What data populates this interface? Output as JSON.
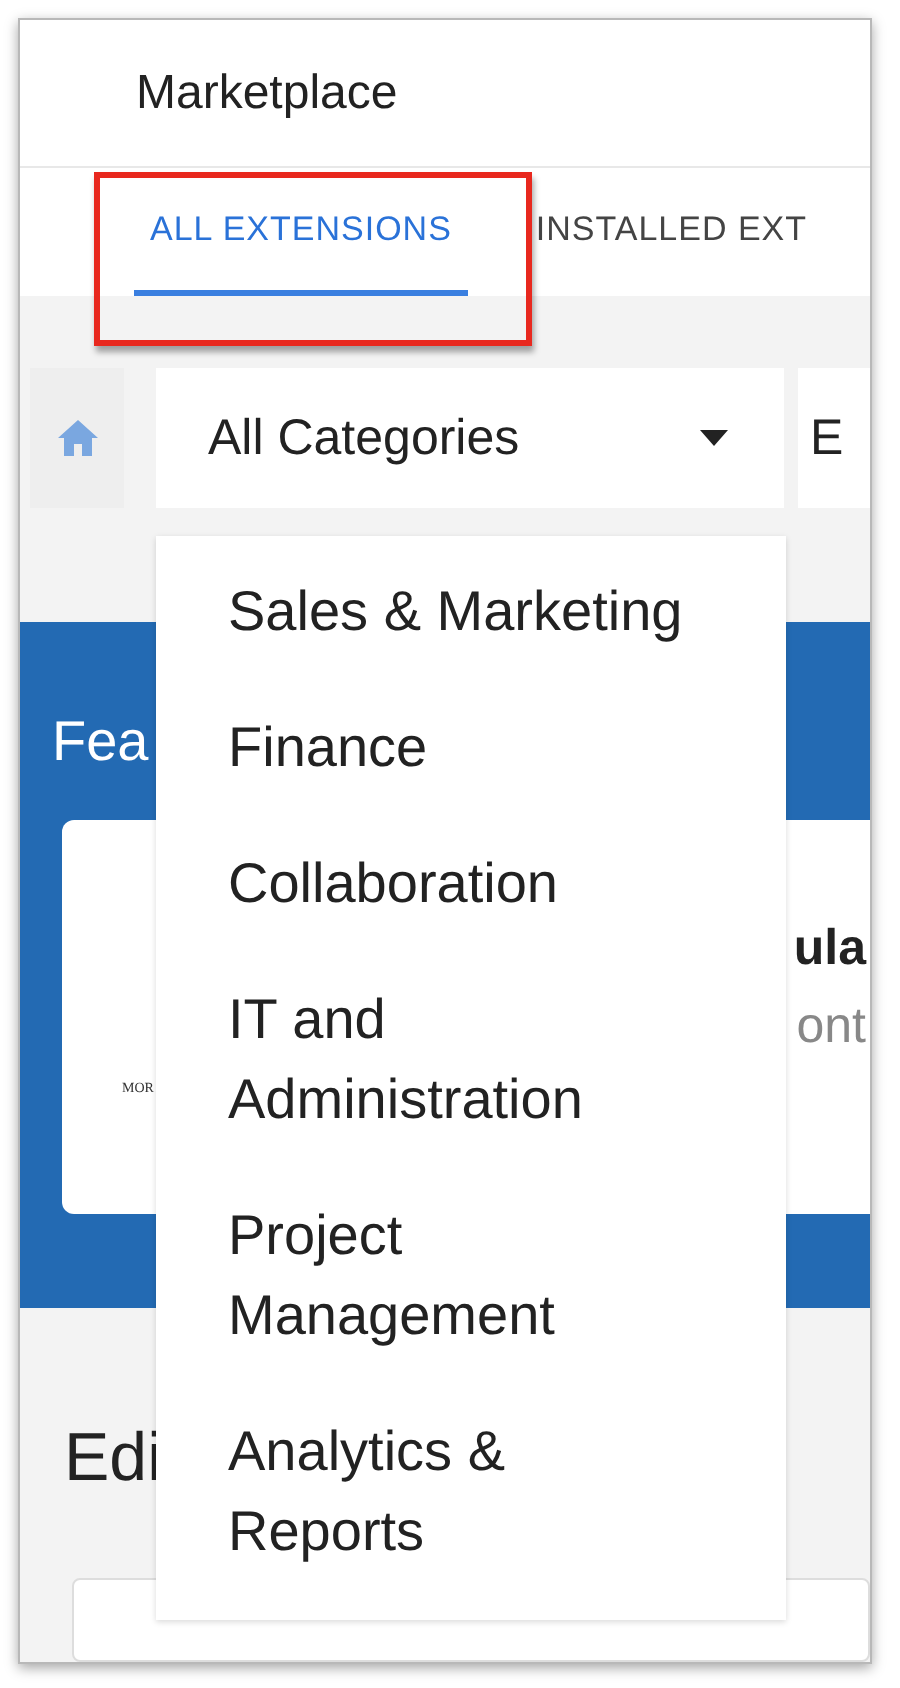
{
  "header": {
    "title": "Marketplace"
  },
  "tabs": [
    {
      "label": "ALL EXTENSIONS",
      "selected": true,
      "highlighted": true
    },
    {
      "label": "INSTALLED EXT",
      "selected": false,
      "highlighted": false
    }
  ],
  "filters": {
    "category": {
      "value": "All Categories",
      "expanded": true
    },
    "field_2": {
      "value": "E"
    }
  },
  "category_menu": {
    "items": [
      {
        "label": "Sales & Marketing"
      },
      {
        "label": "Finance"
      },
      {
        "label": "Collaboration"
      },
      {
        "label": "IT and Administration"
      },
      {
        "label": "Project Management"
      },
      {
        "label": "Analytics & Reports"
      }
    ]
  },
  "featured": {
    "title": "Fea",
    "card": {
      "logo_text": "MOR",
      "title": "ula",
      "subtitle": "ont"
    }
  },
  "section_2": {
    "title": "Edi"
  }
}
